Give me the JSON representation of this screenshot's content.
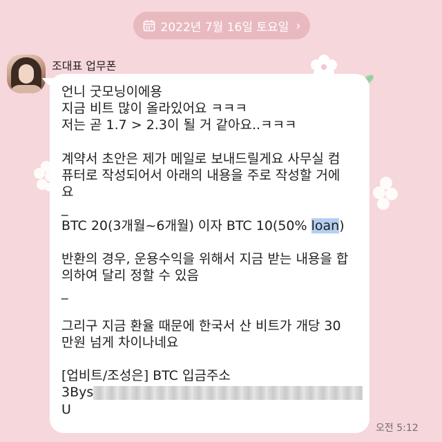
{
  "date_divider": {
    "label": "2022년 7월 16일 토요일",
    "icon": "calendar-icon"
  },
  "sender": {
    "name": "조대표 업무폰"
  },
  "message": {
    "lines": [
      "언니 굿모닝이에용",
      "지금 비트 많이 올라있어요 ㅋㅋㅋ",
      "저는 곧 1.7 > 2.3이 될 거 같아요..ㅋㅋㅋ",
      "",
      "계약서 초안은 제가 메일로 보내드릴게요 사무실 컴",
      "퓨터로 작성되어서 아래의 내용을 주로 작성할 거에",
      "요",
      "_",
      "",
      "",
      "반환의 경우, 운용수익을 위해서 지금 받는 내용을 합",
      "의하여 달리 정할 수 있음",
      "_",
      "",
      "그리구 지금 환율 때문에 한국서 산 비트가 개당 30",
      "만원 넘게 차이나네요",
      "",
      "[업비트/조성은] BTC 입금주소",
      "",
      "U"
    ],
    "btc_line_prefix": "BTC 20(3개월~6개월) 이자 BTC 10(50% ",
    "btc_line_highlight": "loan",
    "btc_line_suffix": ")",
    "address_prefix": "3Bys",
    "time": "오전 5:12"
  },
  "colors": {
    "background": "#f6d7dc",
    "pill": "#e9b9c0",
    "highlight": "#b5cff0"
  }
}
